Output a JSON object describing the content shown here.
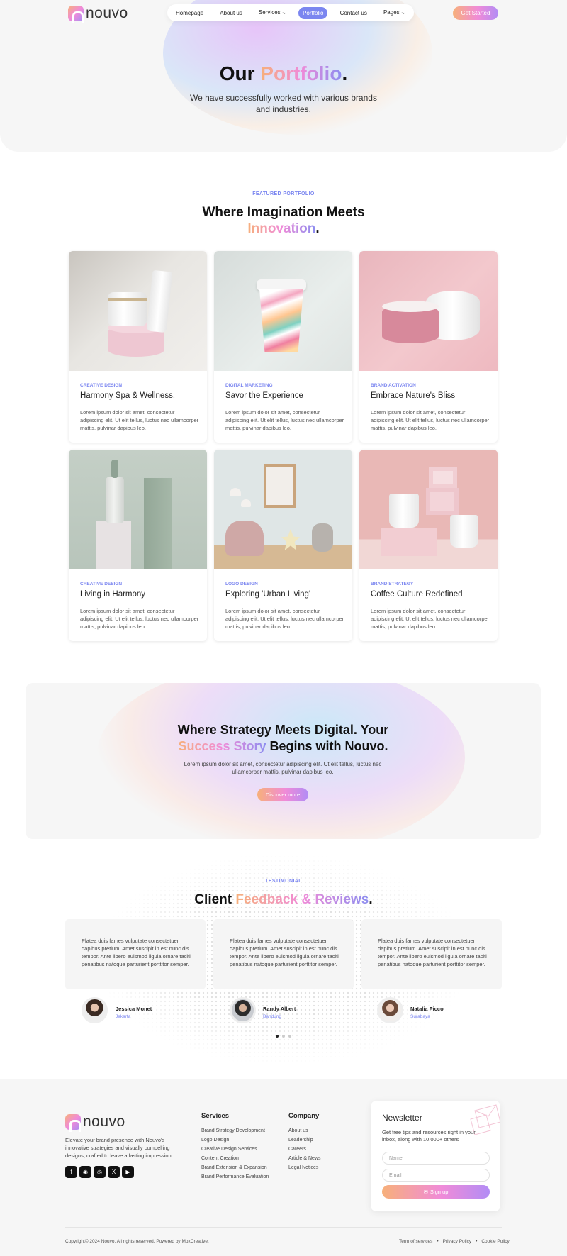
{
  "brand": {
    "name": "nouvo"
  },
  "nav": {
    "items": [
      {
        "label": "Homepage",
        "active": false,
        "dropdown": false
      },
      {
        "label": "About us",
        "active": false,
        "dropdown": false
      },
      {
        "label": "Services",
        "active": false,
        "dropdown": true
      },
      {
        "label": "Portfolio",
        "active": true,
        "dropdown": false
      },
      {
        "label": "Contact us",
        "active": false,
        "dropdown": false
      },
      {
        "label": "Pages",
        "active": false,
        "dropdown": true
      }
    ],
    "cta_label": "Get Started"
  },
  "hero": {
    "title_part1": "Our ",
    "title_highlight": "Portfolio",
    "title_end": ".",
    "subtitle": "We have successfully worked with various brands and industries."
  },
  "featured": {
    "eyebrow": "FEATURED PORTFOLIO",
    "title_line1": "Where Imagination Meets",
    "title_highlight": "Innovation",
    "title_end": "."
  },
  "portfolio": [
    {
      "category": "CREATIVE DESIGN",
      "title": "Harmony Spa & Wellness.",
      "text": "Lorem ipsum dolor sit amet, consectetur adipiscing elit. Ut elit tellus, luctus nec ullamcorper mattis, pulvinar dapibus leo.",
      "image": "cosmetic-jar-and-tube-photo"
    },
    {
      "category": "DIGITAL MARKETING",
      "title": "Savor the Experience",
      "text": "Lorem ipsum dolor sit amet, consectetur adipiscing elit. Ut elit tellus, luctus nec ullamcorper mattis, pulvinar dapibus leo.",
      "image": "paper-coffee-cup-photo"
    },
    {
      "category": "BRAND ACTIVATION",
      "title": "Embrace Nature's Bliss",
      "text": "Lorem ipsum dolor sit amet, consectetur adipiscing elit. Ut elit tellus, luctus nec ullamcorper mattis, pulvinar dapibus leo.",
      "image": "pink-cream-jars-photo"
    },
    {
      "category": "CREATIVE DESIGN",
      "title": "Living in Harmony",
      "text": "Lorem ipsum dolor sit amet, consectetur adipiscing elit. Ut elit tellus, luctus nec ullamcorper mattis, pulvinar dapibus leo.",
      "image": "dropper-bottle-and-box-photo"
    },
    {
      "category": "LOGO DESIGN",
      "title": "Exploring 'Urban Living'",
      "text": "Lorem ipsum dolor sit amet, consectetur adipiscing elit. Ut elit tellus, luctus nec ullamcorper mattis, pulvinar dapibus leo.",
      "image": "kids-room-interior-photo"
    },
    {
      "category": "BRAND STRATEGY",
      "title": "Coffee Culture Redefined",
      "text": "Lorem ipsum dolor sit amet, consectetur adipiscing elit. Ut elit tellus, luctus nec ullamcorper mattis, pulvinar dapibus leo.",
      "image": "white-mugs-on-pink-blocks-photo"
    }
  ],
  "cta": {
    "title_line1": "Where Strategy Meets Digital. Your",
    "title_highlight": "Success Story",
    "title_end": " Begins with Nouvo.",
    "text": "Lorem ipsum dolor sit amet, consectetur adipiscing elit. Ut elit tellus, luctus nec ullamcorper mattis, pulvinar dapibus leo.",
    "button": "Discover more"
  },
  "testimonials": {
    "eyebrow": "TESTIMONIAL",
    "title_part1": "Client ",
    "title_highlight": "Feedback & Reviews",
    "title_end": ".",
    "items": [
      {
        "text": "Platea duis fames vulputate consectetuer dapibus pretium. Amet suscipit in est nunc dis tempor. Ante libero euismod ligula ornare taciti penatibus natoque parturient porttitor semper.",
        "name": "Jessica Monet",
        "city": "Jakarta"
      },
      {
        "text": "Platea duis fames vulputate consectetuer dapibus pretium. Amet suscipit in est nunc dis tempor. Ante libero euismod ligula ornare taciti penatibus natoque parturient porttitor semper.",
        "name": "Randy Albert",
        "city": "Bandung"
      },
      {
        "text": "Platea duis fames vulputate consectetuer dapibus pretium. Amet suscipit in est nunc dis tempor. Ante libero euismod ligula ornare taciti penatibus natoque parturient porttitor semper.",
        "name": "Natalia Picco",
        "city": "Surabaya"
      }
    ]
  },
  "footer": {
    "description": "Elevate your brand presence with Nouvo's innovative strategies and visually compelling designs, crafted to leave a lasting impression.",
    "social_icons": [
      "facebook-icon",
      "instagram-icon",
      "dribbble-icon",
      "x-icon",
      "youtube-icon"
    ],
    "services_heading": "Services",
    "services": [
      "Brand Strategy Development",
      "Logo Design",
      "Creative Design Services",
      "Content Creation",
      "Brand Extension & Expansion",
      "Brand Performance Evaluation"
    ],
    "company_heading": "Company",
    "company": [
      "About us",
      "Leadership",
      "Careers",
      "Article & News",
      "Legal Notices"
    ],
    "newsletter": {
      "title": "Newsletter",
      "text": "Get free tips and resources right in your inbox, along with 10,000+ others",
      "name_placeholder": "Name",
      "email_placeholder": "Email",
      "button": "Sign up"
    },
    "copyright": "Copyright© 2024 Nouvo. All rights reserved. Powered by MoxCreative.",
    "legal_links": [
      "Term of services",
      "Privacy Policy",
      "Cookie Policy"
    ]
  },
  "colors": {
    "accent": "#7b86f0",
    "gradient_start": "#f7b07a",
    "gradient_mid": "#f08bd8",
    "gradient_end": "#8d8df0"
  }
}
